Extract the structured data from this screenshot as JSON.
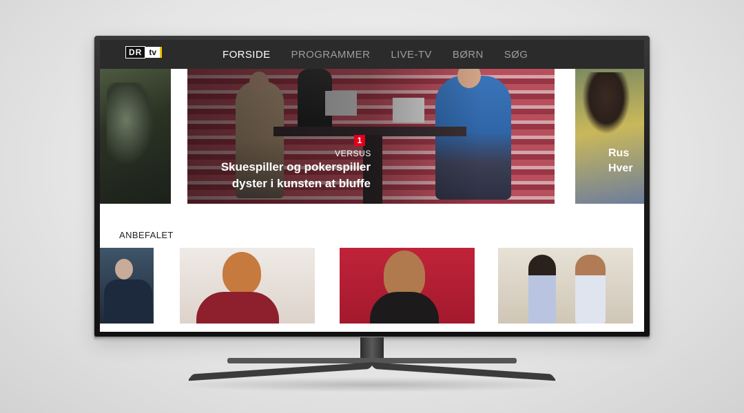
{
  "app": {
    "logo": {
      "dr": "DR",
      "tv": "tv"
    }
  },
  "nav": {
    "items": [
      {
        "label": "FORSIDE",
        "active": true
      },
      {
        "label": "PROGRAMMER",
        "active": false
      },
      {
        "label": "LIVE-TV",
        "active": false
      },
      {
        "label": "BØRN",
        "active": false
      },
      {
        "label": "SØG",
        "active": false
      }
    ]
  },
  "hero": {
    "channel": "1",
    "program": "VERSUS",
    "title_line1": "Skuespiller og pokerspiller",
    "title_line2": "dyster i kunsten at bluffe",
    "next_title_line1": "Rus",
    "next_title_line2": "Hver"
  },
  "recommended": {
    "heading": "ANBEFALET"
  },
  "colors": {
    "nav_bg": "#2b2b2b",
    "nav_active": "#ffffff",
    "nav_inactive": "#9d9d9d",
    "channel_badge": "#e2001a",
    "logo_accent": "#f2c200"
  }
}
